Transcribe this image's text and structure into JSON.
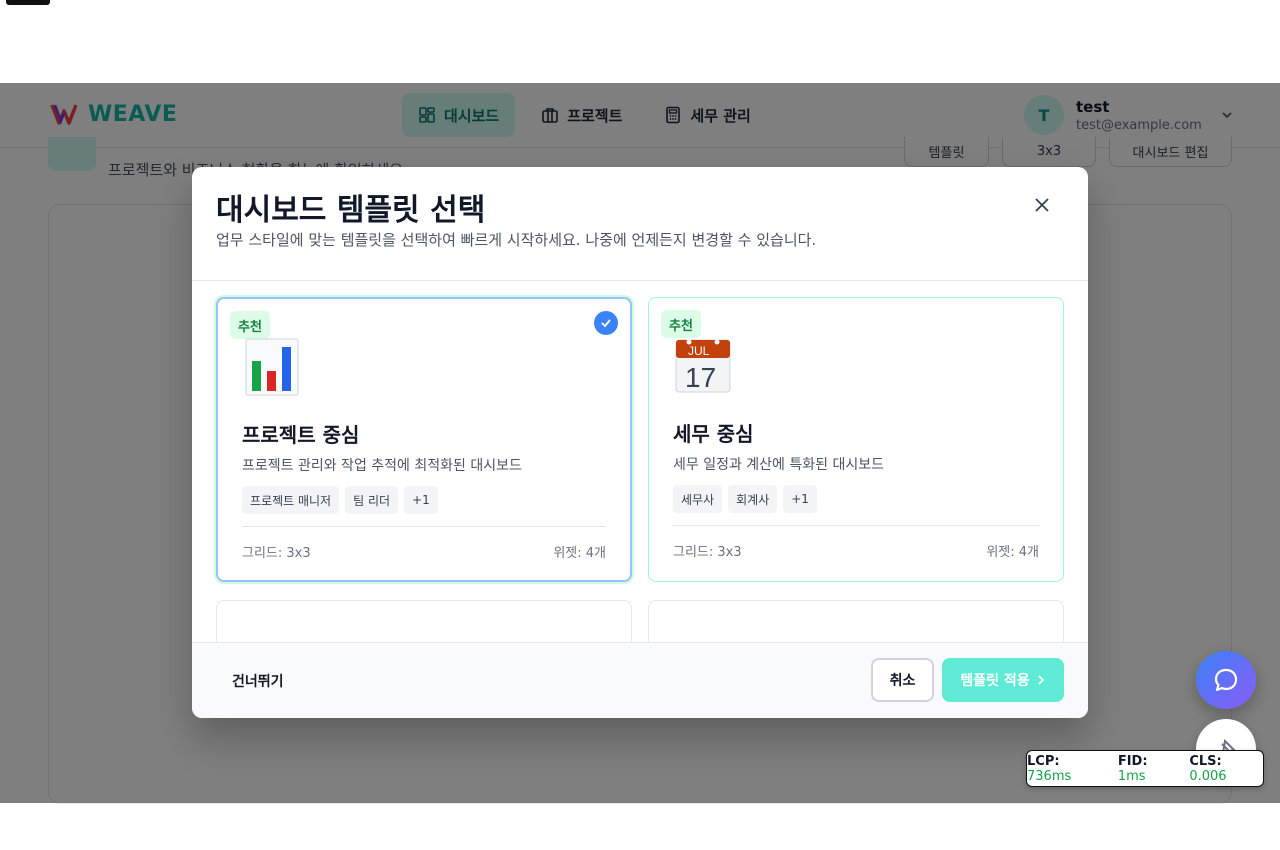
{
  "nav": {
    "logo": "WEAVE",
    "tabs": [
      {
        "label": "대시보드",
        "icon": "dashboard-icon"
      },
      {
        "label": "프로젝트",
        "icon": "briefcase-icon"
      },
      {
        "label": "세무 관리",
        "icon": "calculator-icon"
      }
    ],
    "user": {
      "initial": "T",
      "name": "test",
      "email": "test@example.com"
    }
  },
  "page": {
    "subtitle": "프로젝트와 비즈니스 현황을 한눈에 확인하세요",
    "buttons": [
      "템플릿",
      "3x3",
      "대시보드 편집"
    ]
  },
  "modal": {
    "title": "대시보드 템플릿 선택",
    "description": "업무 스타일에 맞는 템플릿을 선택하여 빠르게 시작하세요. 나중에 언제든지 변경할 수 있습니다.",
    "templates": [
      {
        "badge": "추천",
        "icon": "bar-chart-emoji",
        "name": "프로젝트 중심",
        "description": "프로젝트 관리와 작업 추적에 최적화된 대시보드",
        "tags": [
          "프로젝트 매니저",
          "팀 리더",
          "+1"
        ],
        "grid": "그리드: 3x3",
        "widgets": "위젯: 4개",
        "selected": true
      },
      {
        "badge": "추천",
        "icon": "calendar-emoji",
        "calendar_month": "JUL",
        "calendar_day": "17",
        "name": "세무 중심",
        "description": "세무 일정과 계산에 특화된 대시보드",
        "tags": [
          "세무사",
          "회계사",
          "+1"
        ],
        "grid": "그리드: 3x3",
        "widgets": "위젯: 4개",
        "selected": false
      }
    ],
    "footer": {
      "skip": "건너뛰기",
      "cancel": "취소",
      "apply": "템플릿 적용"
    }
  },
  "vitals": {
    "lcp_label": "LCP:",
    "lcp_value": "736ms",
    "fid_label": "FID:",
    "fid_value": "1ms",
    "cls_label": "CLS:",
    "cls_value": "0.006"
  },
  "colors": {
    "accent": "#14b8a6",
    "selected_check": "#3b82f6",
    "badge_bg": "#dcfce7",
    "badge_text": "#15803d"
  }
}
